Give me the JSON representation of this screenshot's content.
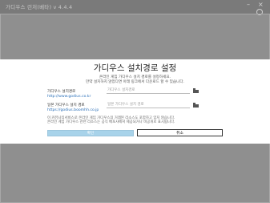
{
  "window": {
    "title": "가디우스 런처(베타)   v 4.4.4",
    "minimize_label": "–",
    "close_label": "×"
  },
  "dialog": {
    "title": "가디우스 설치경로 설정",
    "description_lines": [
      "온라인 게임 가디우스 설치 경로를 설정하세요.",
      "만약 설치하지 않았다면 아래 링크에서 다운로드 할 수 있습니다."
    ],
    "install_path": {
      "label": "가디우스 설치경로",
      "value": "",
      "placeholder": "가디우스 설치경로",
      "link": "http://www.godius.co.kr"
    },
    "jp_install_path": {
      "label": "일본 가디우스 설치 경로",
      "value": "",
      "placeholder": "일본 가디우스 설치 경로",
      "link": "https://godius.boomhh.co.jp"
    },
    "notes": [
      "이 커뮤니티서비스로 온라인 게임 가디우스의 거래된 리소스도 포함하고 있지 않습니다.",
      "온라인 게임 가디우스 관련 리소스는 공식 배포사에서 제공되거나 비공개로 표시됩니다."
    ],
    "ok_label": "확인",
    "cancel_label": "취소"
  }
}
